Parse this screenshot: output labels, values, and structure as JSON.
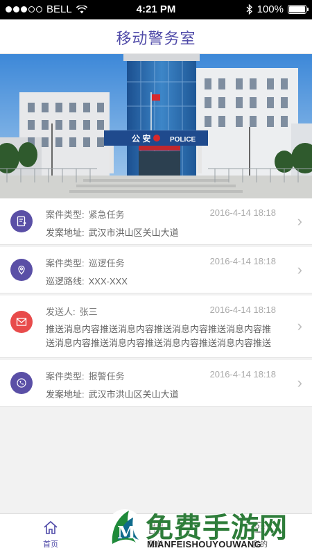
{
  "status_bar": {
    "carrier": "BELL",
    "time": "4:21 PM",
    "battery": "100%",
    "battery_level": 1.0
  },
  "header": {
    "title": "移动警务室"
  },
  "banner": {
    "building_sign_left": "公 安",
    "building_sign_right": "POLICE"
  },
  "items": [
    {
      "line1_label": "案件类型:",
      "line1_value": "紧急任务",
      "time": "2016-4-14 18:18",
      "line2_label": "发案地址:",
      "line2_value": "武汉市洪山区关山大道",
      "icon": "document-icon",
      "icon_color": "#5a4fa6"
    },
    {
      "line1_label": "案件类型:",
      "line1_value": "巡逻任务",
      "time": "2016-4-14 18:18",
      "line2_label": "巡逻路线:",
      "line2_value": "XXX-XXX",
      "icon": "location-icon",
      "icon_color": "#5a4fa6"
    },
    {
      "line1_label": "发送人:",
      "line1_value": "张三",
      "time": "2016-4-14 18:18",
      "message": "推送消息内容推送消息内容推送消息内容推送消息内容推送消息内容推送消息内容推送消息内容推送消息内容推送消息内容...",
      "icon": "mail-icon",
      "icon_color": "#e84b4b"
    },
    {
      "line1_label": "案件类型:",
      "line1_value": "报警任务",
      "time": "2016-4-14 18:18",
      "line2_label": "发案地址:",
      "line2_value": "武汉市洪山区关山大道",
      "icon": "phone-icon",
      "icon_color": "#5a4fa6"
    }
  ],
  "tabbar": {
    "tabs": [
      {
        "label": "首页",
        "icon": "home-icon"
      },
      {
        "label": "菜单",
        "icon": "grid-icon"
      },
      {
        "label": "我的",
        "icon": "profile-icon"
      }
    ]
  },
  "watermark": {
    "cn": "免费手游网",
    "en": "MIANFEISHOUYOUWANG"
  },
  "colors": {
    "accent": "#4f4aa8",
    "alert": "#e84b4b"
  }
}
